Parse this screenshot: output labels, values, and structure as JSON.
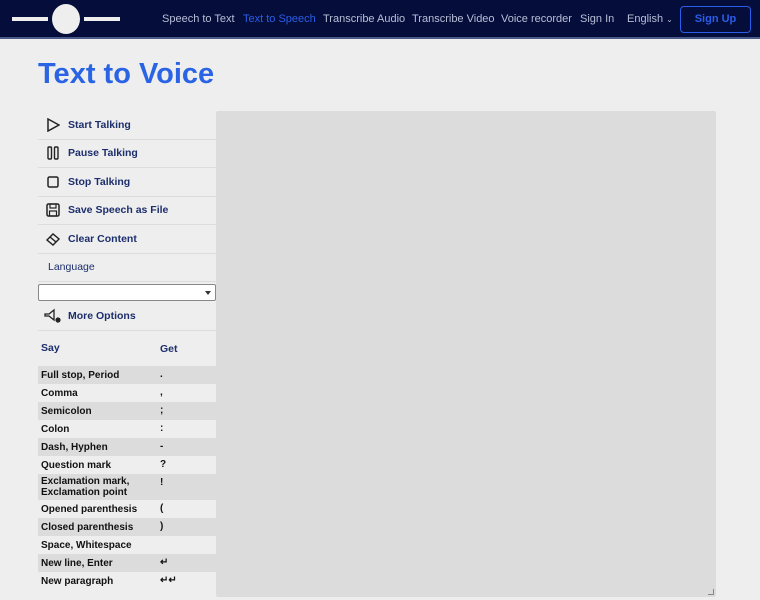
{
  "nav": {
    "items": [
      "Speech to Text",
      "Text to Speech",
      "Transcribe Audio",
      "Transcribe Video",
      "Voice recorder",
      "Sign In",
      "English"
    ],
    "signup": "Sign Up"
  },
  "title": "Text to Voice",
  "controls": {
    "start": "Start Talking",
    "pause": "Pause Talking",
    "stop": "Stop Talking",
    "save": "Save Speech as File",
    "clear": "Clear Content",
    "language": "Language",
    "language_value": "",
    "more": "More Options"
  },
  "table": {
    "headers": [
      "Say",
      "Get"
    ],
    "rows": [
      [
        "Full stop, Period",
        "."
      ],
      [
        "Comma",
        ","
      ],
      [
        "Semicolon",
        ";"
      ],
      [
        "Colon",
        ":"
      ],
      [
        "Dash, Hyphen",
        "-"
      ],
      [
        "Question mark",
        "?"
      ],
      [
        "Exclamation mark, Exclamation point",
        "!"
      ],
      [
        "Opened parenthesis",
        "("
      ],
      [
        "Closed parenthesis",
        ")"
      ],
      [
        "Space, Whitespace",
        ""
      ],
      [
        "New line, Enter",
        "↵"
      ],
      [
        "New paragraph",
        "↵↵"
      ]
    ]
  },
  "text_content": ""
}
